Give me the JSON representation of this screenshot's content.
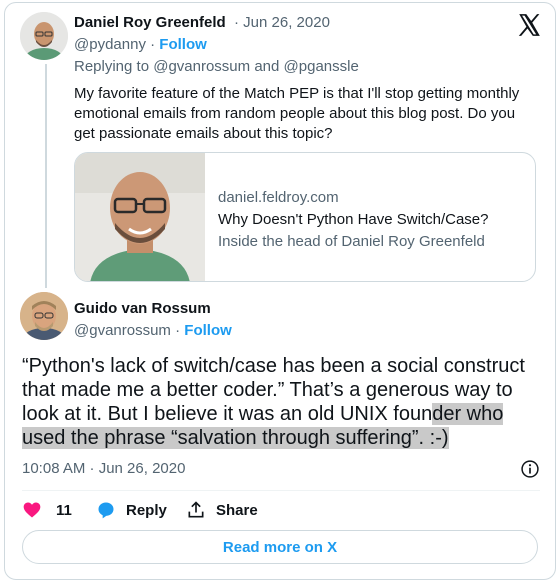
{
  "reply_tweet": {
    "author_name": "Daniel Roy Greenfeld",
    "handle": "@pydanny",
    "date": "Jun 26, 2020",
    "follow_label": "Follow",
    "replying_to_prefix": "Replying to",
    "replying_to_1": "@gvanrossum",
    "replying_to_and": "and",
    "replying_to_2": "@pganssle",
    "text": "My favorite feature of the Match PEP is that I'll stop getting monthly emotional emails from random people about this blog post. Do you get passionate emails about this topic?",
    "link_card": {
      "domain": "daniel.feldroy.com",
      "title": "Why Doesn't Python Have Switch/Case?",
      "description": "Inside the head of Daniel Roy Greenfeld"
    }
  },
  "main_tweet": {
    "author_name": "Guido van Rossum",
    "handle": "@gvanrossum",
    "follow_label": "Follow",
    "text_part1": "“Python's lack of switch/case has been a social construct that made me a better coder.” That’s a generous way to look at it. But I believe it was an old UNIX foun",
    "text_highlight": "der who used the phrase “salvation through suffering”. :-)",
    "timestamp": "10:08 AM · Jun 26, 2020"
  },
  "actions": {
    "like_count": "11",
    "reply_label": "Reply",
    "share_label": "Share"
  },
  "read_more_label": "Read more on X",
  "separator": "·",
  "colors": {
    "accent": "#1d9bf0",
    "like": "#f91880",
    "secondary_text": "#536471",
    "border": "#cfd9de"
  },
  "icons": [
    "x-logo-icon",
    "info-icon",
    "heart-icon",
    "reply-bubble-icon",
    "share-icon"
  ]
}
